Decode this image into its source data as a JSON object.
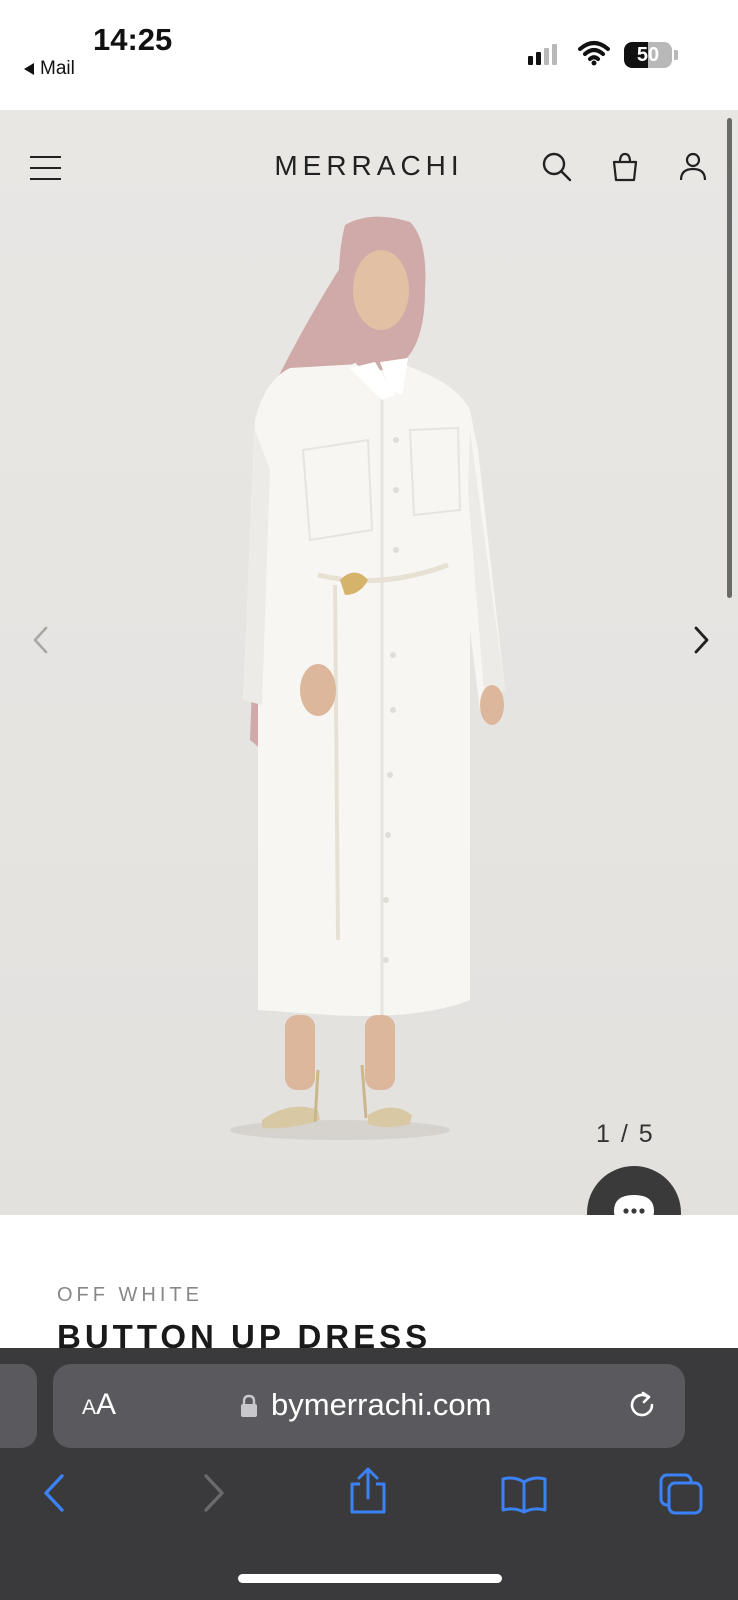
{
  "status_bar": {
    "time": "14:25",
    "back_app": "Mail",
    "battery": "50",
    "battery_level": 0.5
  },
  "site": {
    "brand": "MERRACHI",
    "icons": [
      "menu-icon",
      "search-icon",
      "bag-icon",
      "account-icon"
    ]
  },
  "carousel": {
    "counter": "1 / 5"
  },
  "product": {
    "color": "OFF WHITE",
    "title": "BUTTON UP DRESS"
  },
  "browser": {
    "text_size_label_small": "A",
    "text_size_label": "A",
    "url": "bymerrachi.com"
  },
  "colors": {
    "browser_bg": "#3a3a3c",
    "browser_pill": "#5a5a5e",
    "accent_blue": "#3b82f6",
    "hero_bg": "#e8e6e3"
  }
}
